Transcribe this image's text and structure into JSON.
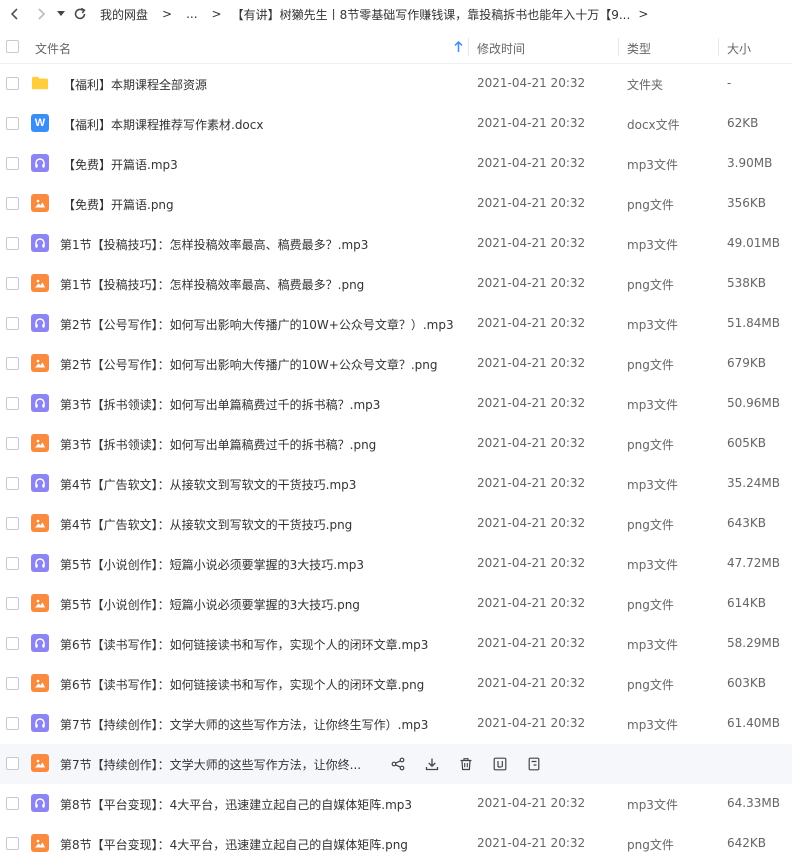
{
  "breadcrumb": {
    "root": "我的网盘",
    "ellipsis": "...",
    "current": "【有讲】树獭先生丨8节零基础写作赚钱课，靠投稿拆书也能年入十万【9..."
  },
  "columns": {
    "name": "文件名",
    "modified": "修改时间",
    "type": "类型",
    "size": "大小"
  },
  "colors": {
    "folder": "#ffcd3e",
    "audio": "#8d84f3",
    "image": "#fb8a41",
    "doc": "#3b8df6",
    "accent": "#3b8df6"
  },
  "files": [
    {
      "icon": "folder-icon",
      "name": "【福利】本期课程全部资源",
      "time": "2021-04-21 20:32",
      "type": "文件夹",
      "size": "-"
    },
    {
      "icon": "word-doc-icon",
      "name": "【福利】本期课程推荐写作素材.docx",
      "time": "2021-04-21 20:32",
      "type": "docx文件",
      "size": "62KB"
    },
    {
      "icon": "audio-file-icon",
      "name": "【免费】开篇语.mp3",
      "time": "2021-04-21 20:32",
      "type": "mp3文件",
      "size": "3.90MB"
    },
    {
      "icon": "image-file-icon",
      "name": "【免费】开篇语.png",
      "time": "2021-04-21 20:32",
      "type": "png文件",
      "size": "356KB"
    },
    {
      "icon": "audio-file-icon",
      "name": "第1节【投稿技巧】：怎样投稿效率最高、稿费最多？.mp3",
      "time": "2021-04-21 20:32",
      "type": "mp3文件",
      "size": "49.01MB"
    },
    {
      "icon": "image-file-icon",
      "name": "第1节【投稿技巧】：怎样投稿效率最高、稿费最多？.png",
      "time": "2021-04-21 20:32",
      "type": "png文件",
      "size": "538KB"
    },
    {
      "icon": "audio-file-icon",
      "name": "第2节【公号写作】：如何写出影响大传播广的10W+公众号文章？）.mp3",
      "time": "2021-04-21 20:32",
      "type": "mp3文件",
      "size": "51.84MB"
    },
    {
      "icon": "image-file-icon",
      "name": "第2节【公号写作】：如何写出影响大传播广的10W+公众号文章？.png",
      "time": "2021-04-21 20:32",
      "type": "png文件",
      "size": "679KB"
    },
    {
      "icon": "audio-file-icon",
      "name": "第3节【拆书领读】：如何写出单篇稿费过千的拆书稿？.mp3",
      "time": "2021-04-21 20:32",
      "type": "mp3文件",
      "size": "50.96MB"
    },
    {
      "icon": "image-file-icon",
      "name": "第3节【拆书领读】：如何写出单篇稿费过千的拆书稿？.png",
      "time": "2021-04-21 20:32",
      "type": "png文件",
      "size": "605KB"
    },
    {
      "icon": "audio-file-icon",
      "name": "第4节【广告软文】：从接软文到写软文的干货技巧.mp3",
      "time": "2021-04-21 20:32",
      "type": "mp3文件",
      "size": "35.24MB"
    },
    {
      "icon": "image-file-icon",
      "name": "第4节【广告软文】：从接软文到写软文的干货技巧.png",
      "time": "2021-04-21 20:32",
      "type": "png文件",
      "size": "643KB"
    },
    {
      "icon": "audio-file-icon",
      "name": "第5节【小说创作】：短篇小说必须要掌握的3大技巧.mp3",
      "time": "2021-04-21 20:32",
      "type": "mp3文件",
      "size": "47.72MB"
    },
    {
      "icon": "image-file-icon",
      "name": "第5节【小说创作】：短篇小说必须要掌握的3大技巧.png",
      "time": "2021-04-21 20:32",
      "type": "png文件",
      "size": "614KB"
    },
    {
      "icon": "audio-file-icon",
      "name": "第6节【读书写作】：如何链接读书和写作，实现个人的闭环文章.mp3",
      "time": "2021-04-21 20:32",
      "type": "mp3文件",
      "size": "58.29MB"
    },
    {
      "icon": "image-file-icon",
      "name": "第6节【读书写作】：如何链接读书和写作，实现个人的闭环文章.png",
      "time": "2021-04-21 20:32",
      "type": "png文件",
      "size": "603KB"
    },
    {
      "icon": "audio-file-icon",
      "name": "第7节【持续创作】：文学大师的这些写作方法，让你终生写作）.mp3",
      "time": "2021-04-21 20:32",
      "type": "mp3文件",
      "size": "61.40MB"
    },
    {
      "icon": "image-file-icon",
      "name": "第7节【持续创作】：文学大师的这些写作方法，让你终...",
      "time": "",
      "type": "",
      "size": "",
      "hover": true
    },
    {
      "icon": "audio-file-icon",
      "name": "第8节【平台变现】：4大平台，迅速建立起自己的自媒体矩阵.mp3",
      "time": "2021-04-21 20:32",
      "type": "mp3文件",
      "size": "64.33MB"
    },
    {
      "icon": "image-file-icon",
      "name": "第8节【平台变现】：4大平台，迅速建立起自己的自媒体矩阵.png",
      "time": "2021-04-21 20:32",
      "type": "png文件",
      "size": "642KB"
    }
  ],
  "hover_actions": [
    "share-icon",
    "download-icon",
    "delete-icon",
    "rename-icon",
    "more-icon"
  ]
}
